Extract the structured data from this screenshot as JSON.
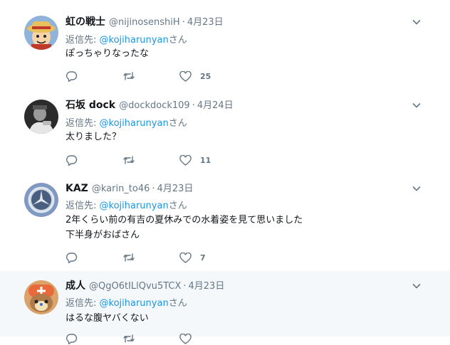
{
  "reply_prefix": "返信先: ",
  "reply_suffix": "さん",
  "tweets": [
    {
      "name": "虹の戦士",
      "handle": "@nijinosenshiH",
      "separator": "·",
      "date": "4月23日",
      "reply_to": "@kojiharunyan",
      "lines": [
        "ぽっちゃりなったな"
      ],
      "likes": "25",
      "avatar_icon": "luffy-avatar-icon",
      "avatar_colors": {
        "bg": "#8fb3d9",
        "hat": "#e8c15a",
        "band": "#c0392b",
        "face": "#f6d3a8"
      }
    },
    {
      "name": "石坂 dock",
      "handle": "@dockdock109",
      "separator": "·",
      "date": "4月24日",
      "reply_to": "@kojiharunyan",
      "lines": [
        "太りました？"
      ],
      "likes": "11",
      "avatar_icon": "monochrome-photo-avatar-icon",
      "avatar_colors": {
        "bg": "#2b2b2b",
        "hat": "#e6e6e6",
        "band": "#555555",
        "face": "#9a9a9a"
      }
    },
    {
      "name": "KAZ",
      "handle": "@karin_to46",
      "separator": "·",
      "date": "4月23日",
      "reply_to": "@kojiharunyan",
      "lines": [
        "2年くらい前の有吉の夏休みでの水着姿を見て思いました",
        "下半身がおばさん"
      ],
      "likes": "7",
      "avatar_icon": "mercedes-logo-avatar-icon",
      "avatar_colors": {
        "bg": "#7f99c2",
        "hat": "#dfe6ee",
        "band": "#4a5f80",
        "face": "#c9d3df"
      }
    },
    {
      "name": "成人",
      "handle": "@QgO6tILlQvu5TCX",
      "separator": "·",
      "date": "4月23日",
      "reply_to": "@kojiharunyan",
      "lines": [
        "はるな腹ヤバくない"
      ],
      "likes": "",
      "avatar_icon": "chopper-avatar-icon",
      "avatar_colors": {
        "bg": "#d9a36a",
        "hat": "#e86a3a",
        "band": "#f2e2b8",
        "face": "#b07a4a"
      }
    }
  ],
  "colors": {
    "text": "#14171a",
    "secondary": "#657786",
    "link": "#1b95e0",
    "border": "#e6ecf0",
    "highlight_bg": "#f5f8fa"
  }
}
